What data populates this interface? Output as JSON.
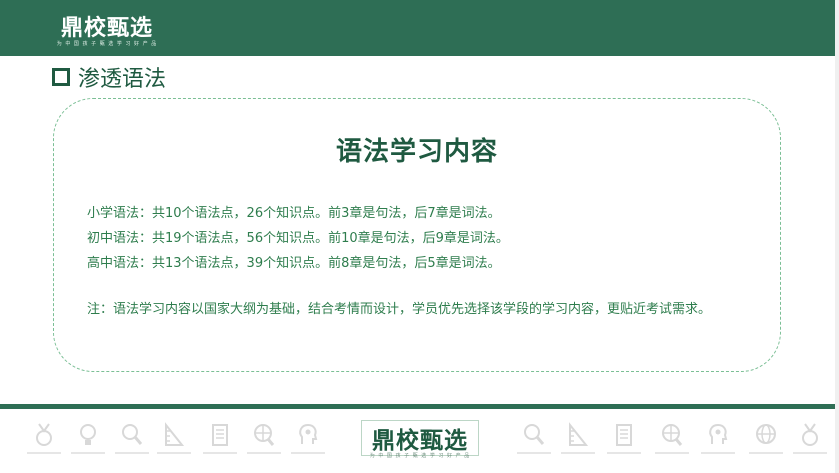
{
  "header": {
    "logo_text": "鼎校甄选",
    "logo_slogan": "为 中 国 孩 子 甄 选 学 习 好 产 品"
  },
  "section": {
    "title": "渗透语法"
  },
  "card": {
    "title": "语法学习内容",
    "lines": [
      "小学语法：共10个语法点，26个知识点。前3章是句法，后7章是词法。",
      "初中语法：共19个语法点，56个知识点。前10章是句法，后9章是词法。",
      "高中语法：共13个语法点，39个知识点。前8章是句法，后5章是词法。"
    ],
    "note": "注：语法学习内容以国家大纲为基础，结合考情而设计，学员优先选择该学段的学习内容，更贴近考试需求。"
  },
  "footer": {
    "logo_text": "鼎校甄选",
    "logo_slogan": "为 中 国 孩 子 甄 选 学 习 好 产 品",
    "icons": [
      "medal-icon",
      "lightbulb-icon",
      "magnifier-icon",
      "ruler-icon",
      "book-icon",
      "globe-search-icon",
      "head-idea-icon",
      "magnifier-icon",
      "ruler-icon",
      "book-icon",
      "globe-search-icon",
      "head-idea-icon",
      "globe-icon",
      "medal-icon"
    ]
  },
  "colors": {
    "brand_green": "#2e6e55",
    "text_green": "#2e7d4d",
    "title_green": "#1f5a41"
  }
}
